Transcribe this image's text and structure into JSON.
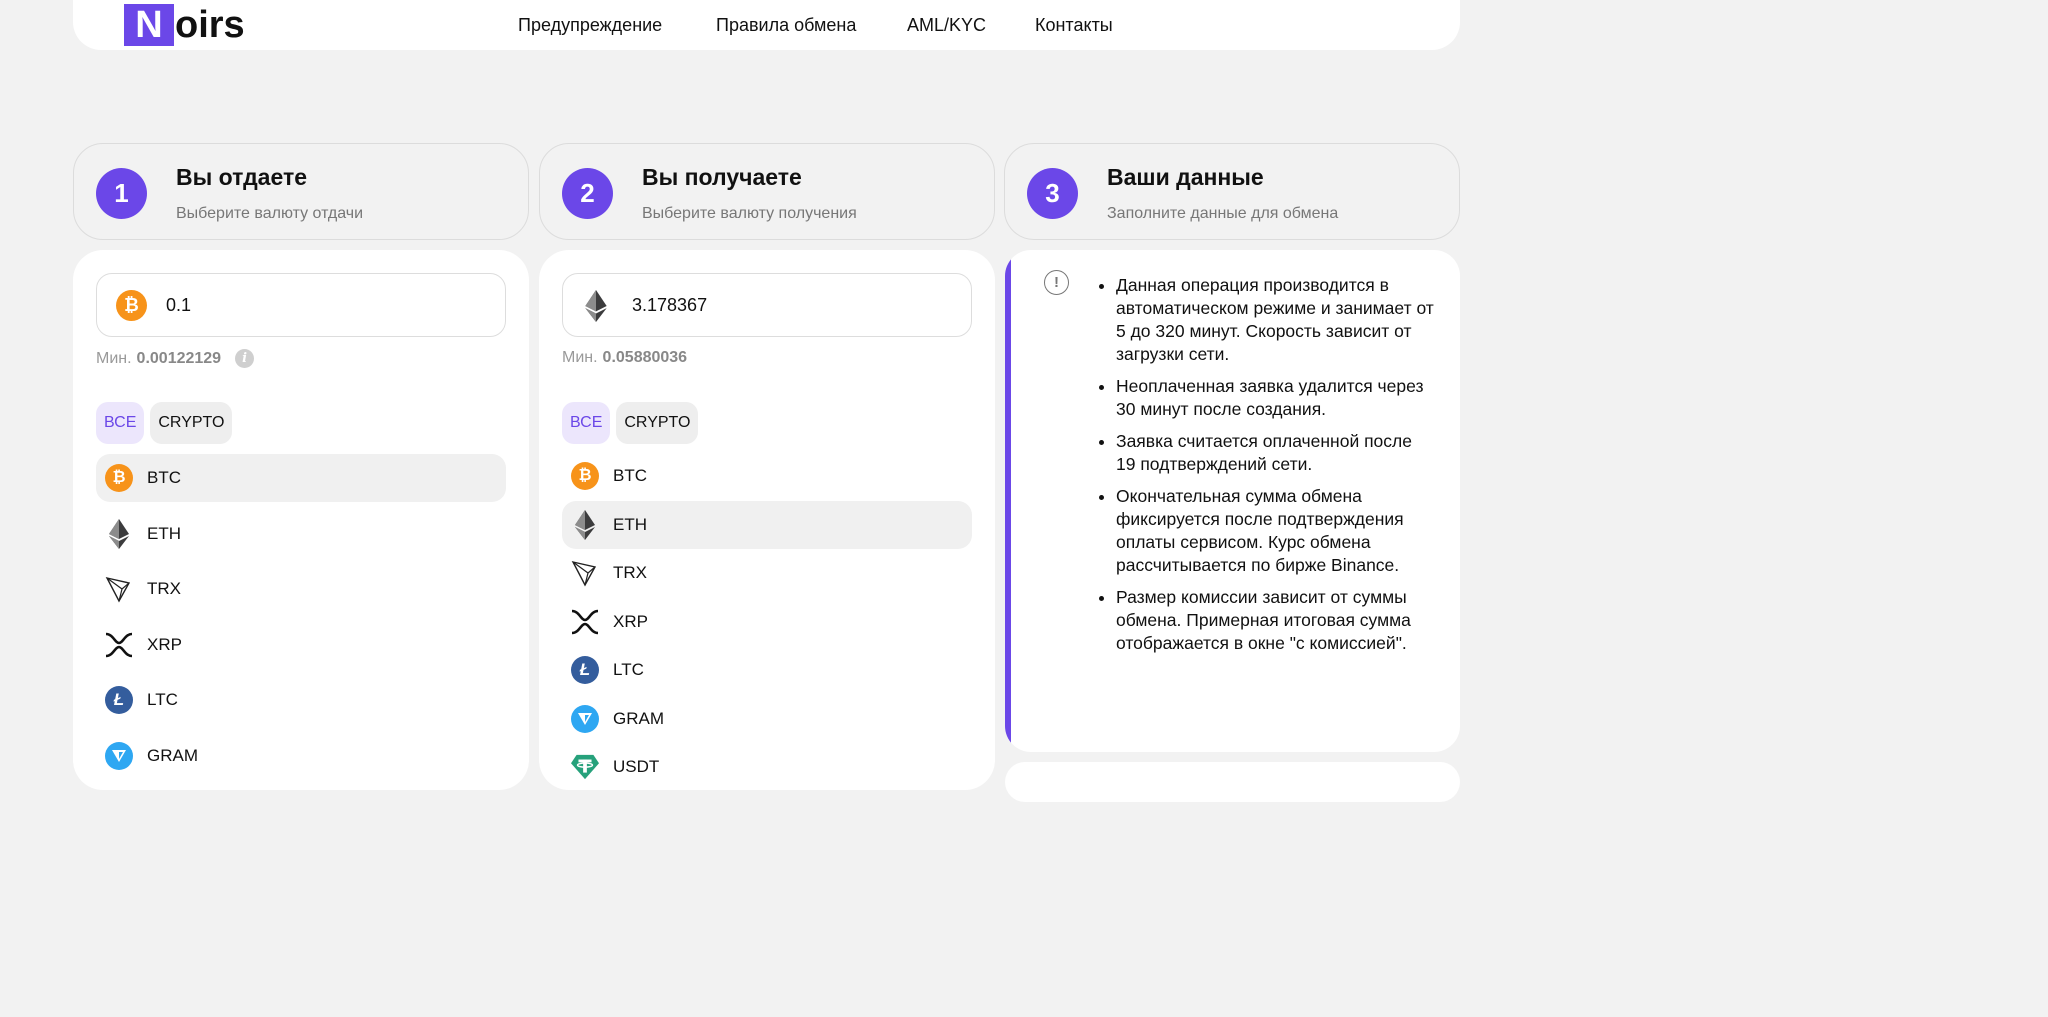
{
  "header": {
    "logo_letter": "N",
    "logo_rest": "oirs",
    "nav": [
      "Предупреждение",
      "Правила обмена",
      "AML/KYC",
      "Контакты"
    ]
  },
  "steps": [
    {
      "num": "1",
      "title": "Вы отдаете",
      "sub": "Выберите валюту отдачи"
    },
    {
      "num": "2",
      "title": "Вы получаете",
      "sub": "Выберите валюту получения"
    },
    {
      "num": "3",
      "title": "Ваши данные",
      "sub": "Заполните данные для обмена"
    }
  ],
  "give": {
    "amount": "0.1",
    "min_label": "Мин.",
    "min_value": "0.00122129",
    "filters": [
      "ВСЕ",
      "CRYPTO"
    ],
    "items": [
      "BTC",
      "ETH",
      "TRX",
      "XRP",
      "LTC",
      "GRAM"
    ],
    "selected": "BTC"
  },
  "receive": {
    "amount": "3.178367",
    "min_label": "Мин.",
    "min_value": "0.05880036",
    "filters": [
      "ВСЕ",
      "CRYPTO"
    ],
    "items": [
      "BTC",
      "ETH",
      "TRX",
      "XRP",
      "LTC",
      "GRAM",
      "USDT"
    ],
    "selected": "ETH"
  },
  "notice": {
    "items": [
      "Данная операция производится в автоматическом режиме и занимает от 5 до 320 минут. Скорость зависит от загрузки сети.",
      "Неоплаченная заявка удалится через 30 минут после создания.",
      "Заявка считается оплаченной после 19 подтверждений сети.",
      "Окончательная сумма обмена фиксируется после подтверждения оплаты сервисом. Курс обмена рассчитывается по бирже Binance.",
      "Размер комиссии зависит от суммы обмена. Примерная итоговая сумма отображается в окне \"с комиссией\"."
    ]
  },
  "colors": {
    "accent": "#6b47e8",
    "btc": "#f7931a",
    "ltc": "#345d9d",
    "gram": "#2ea7f2",
    "usdt": "#26a17b"
  },
  "icons": {
    "BTC": "bitcoin-icon",
    "ETH": "ethereum-icon",
    "TRX": "tron-icon",
    "XRP": "ripple-icon",
    "LTC": "litecoin-icon",
    "GRAM": "gram-icon",
    "USDT": "tether-icon"
  }
}
